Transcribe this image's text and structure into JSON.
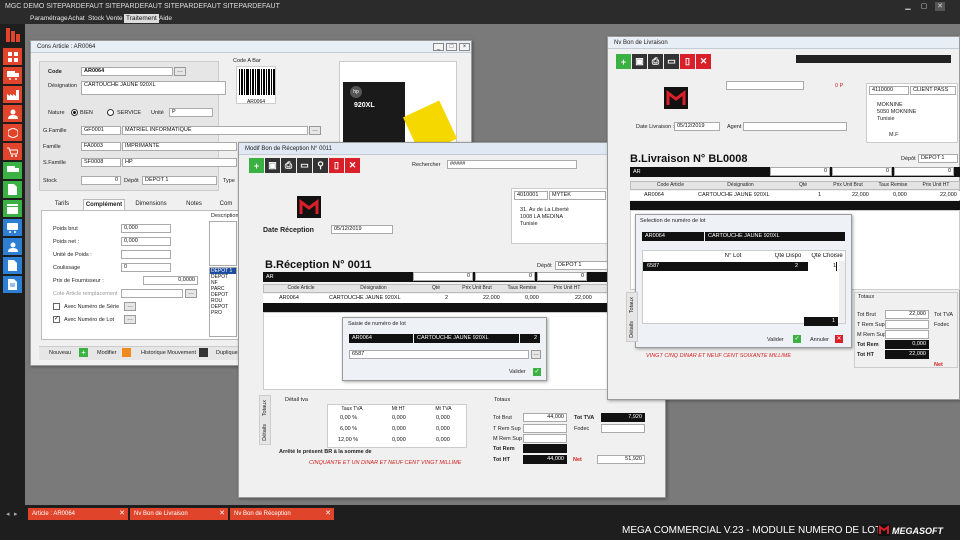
{
  "app": {
    "title": "MGC DEMO SITEPARDEFAUT SITEPARDEFAUT SITEPARDEFAUT SITEPARDEFAUT",
    "footer": "MEGA COMMERCIAL V.23 - MODULE NUMERO  DE LOT",
    "brand": "MEGASOFT"
  },
  "menu": [
    "Paramétrage",
    "Achat",
    "Stock",
    "Vente",
    "Traitement",
    "Aide"
  ],
  "cons": {
    "title": "Cons Article : AR0064",
    "code_label": "Code",
    "code": "AR0064",
    "designation_label": "Désignation",
    "designation": "CARTOUCHE JAUNE 920XL",
    "codebar_label": "Code A Bar",
    "barcode_text": "AR0064",
    "ink_label": "920XL",
    "nature_label": "Nature",
    "nature_bien": "BIEN",
    "nature_service": "SERVICE",
    "unite_label": "Unité",
    "unite": "P",
    "gfamille_label": "G.Famille",
    "gfamille_code": "GF0001",
    "gfamille": "MATRIEL INFORMATIQUE",
    "famille_label": "Famille",
    "famille_code": "FA0003",
    "famille": "IMPRIMANTE",
    "sfamille_label": "S.Famille",
    "sfamille_code": "SF0008",
    "sfamille": "HP",
    "stock_label": "Stock",
    "stock": "0",
    "depot_label": "Dépôt",
    "depot": "DEPOT 1",
    "type_label": "Type",
    "tabs": [
      "Tarifs",
      "Complément",
      "Dimensions",
      "Notes",
      "Com"
    ],
    "poids_brut_label": "Poids brut",
    "poids_brut": "0,000",
    "poids_net_label": "Poids net :",
    "poids_net": "0,000",
    "unite_poids_label": "Unité de Poids :",
    "coulissage_label": "Coulissage",
    "coulissage": "0",
    "prix_fournisseur_label": "Prix de Fournisseur :",
    "prix_fournisseur": "0,0000",
    "cote_label": "Cote Article remplacement",
    "serie_label": "Avec Numéro de Série",
    "lot_label": "Avec Numéro de Lot",
    "description_label": "Description",
    "depots": [
      "DEPOT 1",
      "DEPOT NF",
      "PARC",
      "DEPOT ROU",
      "DEPOT PRO"
    ],
    "nouveau": "Nouveau",
    "modifier": "Modifier",
    "historique": "Historique Mouvement",
    "dupliquer": "Dupliquer"
  },
  "br": {
    "title": "Modif  Bon de Réception N° 0011",
    "rechercher_label": "Rechercher",
    "rechercher": "#####",
    "date_label": "Date Réception",
    "date": "05/12/2019",
    "supplier_code": "4010001",
    "supplier_name": "MYTEK",
    "address1": "31. Av de La Liberté",
    "address2": "1008  LA MEDINA",
    "country": "Tunisie",
    "heading": "B.Réception N° 0011",
    "depot_label": "Dépôt",
    "depot": "DEPOT 1",
    "ar": "AR",
    "zero1": "0",
    "zero2": "0",
    "zero3": "0",
    "cols": [
      "Code Article",
      "Désignation",
      "Qté",
      "Prix Unit Brut",
      "Taux Remise",
      "Prix Unit HT",
      "Pri"
    ],
    "row": {
      "code": "AR0064",
      "designation": "CARTOUCHE JAUNE 920XL",
      "qte": "2",
      "prix_brut": "22,000",
      "remise": "0,000",
      "prix_ht": "22,000"
    },
    "lot_dialog": {
      "title": "Saisie de numéro de lot",
      "code": "AR0064",
      "designation": "CARTOUCHE JAUNE 920XL",
      "qty": "2",
      "value": "6587",
      "valider": "Valider"
    },
    "side_tabs": [
      "Totaux",
      "Détails"
    ],
    "detail_label": "Détail tva",
    "tva_cols": [
      "Taux TVA",
      "Mt HT",
      "Mt TVA"
    ],
    "tva_rows": [
      [
        "0,00 %",
        "0,000",
        "0,000"
      ],
      [
        "6,00 %",
        "0,000",
        "0,000"
      ],
      [
        "12,00 %",
        "0,000",
        "0,000"
      ]
    ],
    "arrete": "Arrêté le présent BR à la somme de",
    "amount_text": "CINQUANTE ET UN DINAR ET NEUF CENT VINGT MILLIME",
    "totaux_label": "Totaux",
    "tot_brut_label": "Tot Brut",
    "tot_brut": "44,000",
    "t_rem_sup_label": "T Rem Sup",
    "m_rem_sup_label": "M Rem Sup",
    "tot_rem_label": "Tot Rem",
    "tot_ht_label": "Tot HT",
    "tot_ht": "44,000",
    "tot_tva_label": "Tot TVA",
    "tot_tva": "7,920",
    "fodec_label": "Fodec",
    "net_label": "Net",
    "net": "51,920"
  },
  "bl": {
    "title": "Nv  Bon de Livraison",
    "date_label": "Date Livraison :",
    "date": "05/12/2019",
    "agent_label": "Agent",
    "client_code": "4110000",
    "client_name": "CLIENT PASS",
    "city1": "MOKNINE",
    "city2": "5050  MOKNINE",
    "country": "Tunisie",
    "mf": "M.F",
    "heading": "B.Livraison N°   BL0008",
    "depot_label": "Dépôt",
    "depot": "DEPOT 1",
    "ar": "AR",
    "zero1": "0",
    "zero2": "0",
    "zero3": "0",
    "zero_p": "0 P",
    "cols": [
      "Code Article",
      "Désignation",
      "Qté",
      "Prix Unit Brut",
      "Taux Remise",
      "Prix Unit HT"
    ],
    "row": {
      "code": "AR0064",
      "designation": "CARTOUCHE JAUNE 920XL",
      "qte": "1",
      "prix_brut": "22,000",
      "remise": "0,000",
      "prix_ht": "22,000"
    },
    "lot_dialog": {
      "title": "Selection de numéro de lot",
      "code": "AR0064",
      "designation": "CARTOUCHE JAUNE 920XL",
      "cols": [
        "N° Lot",
        "Qté Dispo",
        "Qté Choisie"
      ],
      "row": {
        "lot": "6587",
        "dispo": "2",
        "choisie": "1"
      },
      "total": "1",
      "valider": "Valider",
      "annuler": "Annuler"
    },
    "amount_text": "VINGT CINQ DINAR ET NEUF CENT SOIXANTE MILLIME",
    "totaux_label": "Totaux",
    "tot_brut_label": "Tot Brut",
    "tot_brut": "22,000",
    "t_rem_sup_label": "T Rem Sup",
    "m_rem_sup_label": "M Rem Sup",
    "tot_rem_label": "Tot Rem",
    "tot_rem": "0,000",
    "tot_ht_label": "Tot HT",
    "tot_ht": "22,000",
    "tot_tva_label": "Tot TVA",
    "fodec_label": "Fodec",
    "net_label": "Net",
    "side_tabs": [
      "Totaux",
      "Détails"
    ]
  },
  "tasks": [
    "Article : AR0064",
    "Nv Bon de Livraison",
    "Nv Bon de Réception"
  ],
  "colors": {
    "accent_red": "#e0452b",
    "green": "#3bb143",
    "red": "#d9202a"
  }
}
